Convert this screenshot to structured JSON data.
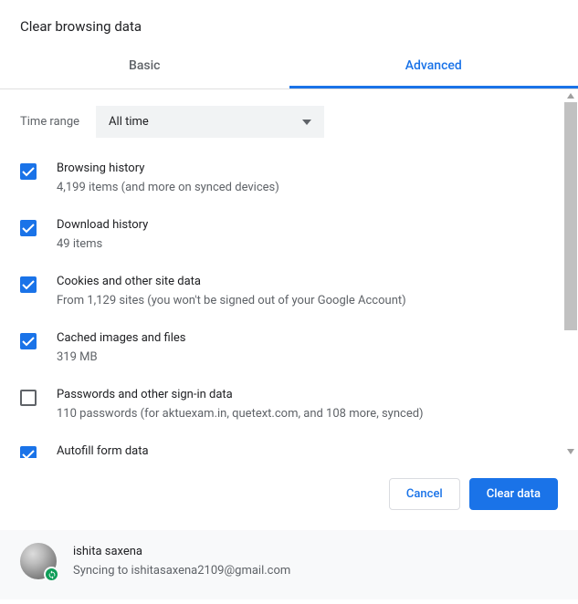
{
  "dialog": {
    "title": "Clear browsing data"
  },
  "tabs": {
    "basic": "Basic",
    "advanced": "Advanced"
  },
  "timeRange": {
    "label": "Time range",
    "value": "All time"
  },
  "items": [
    {
      "title": "Browsing history",
      "sub": "4,199 items (and more on synced devices)",
      "checked": true
    },
    {
      "title": "Download history",
      "sub": "49 items",
      "checked": true
    },
    {
      "title": "Cookies and other site data",
      "sub": "From 1,129 sites (you won't be signed out of your Google Account)",
      "checked": true
    },
    {
      "title": "Cached images and files",
      "sub": "319 MB",
      "checked": true
    },
    {
      "title": "Passwords and other sign-in data",
      "sub": "110 passwords (for aktuexam.in, quetext.com, and 108 more, synced)",
      "checked": false
    },
    {
      "title": "Autofill form data",
      "sub": "",
      "checked": true
    }
  ],
  "buttons": {
    "cancel": "Cancel",
    "clear": "Clear data"
  },
  "account": {
    "name": "ishita saxena",
    "status": "Syncing to ishitasaxena2109@gmail.com"
  }
}
